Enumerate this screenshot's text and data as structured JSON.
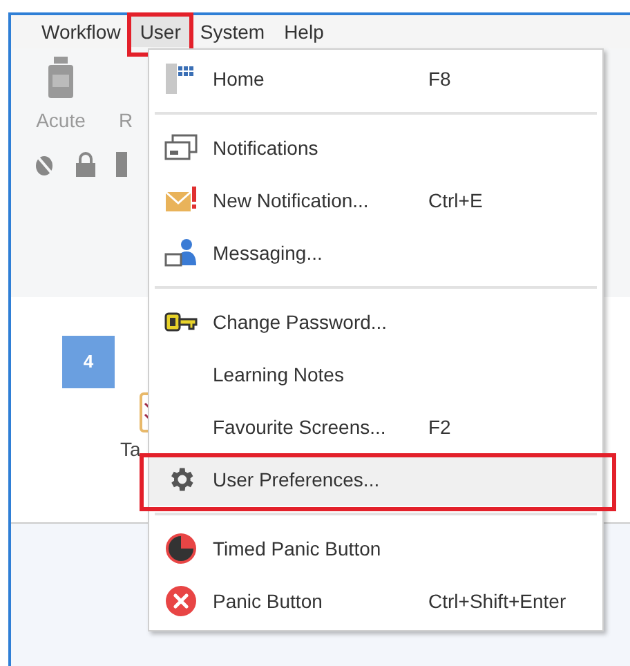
{
  "menu_bar": [
    {
      "label": "Workflow",
      "selected": false,
      "highlighted": false
    },
    {
      "label": "User",
      "selected": true,
      "highlighted": true
    },
    {
      "label": "System",
      "selected": false,
      "highlighted": false
    },
    {
      "label": "Help",
      "selected": false,
      "highlighted": false
    }
  ],
  "toolbar": {
    "buttons": [
      {
        "label": "Acute"
      },
      {
        "label": "R"
      }
    ]
  },
  "workspace": {
    "tile": {
      "badge": "4",
      "label": "Ta"
    }
  },
  "user_menu": [
    {
      "label": "Home",
      "shortcut": "F8",
      "selected": false,
      "highlighted": false,
      "separator_after": true
    },
    {
      "label": "Notifications",
      "selected": false,
      "highlighted": false,
      "separator_after": false
    },
    {
      "label": "New Notification...",
      "shortcut": "Ctrl+E",
      "selected": false,
      "highlighted": false,
      "separator_after": false
    },
    {
      "label": "Messaging...",
      "selected": false,
      "highlighted": false,
      "separator_after": true
    },
    {
      "label": "Change Password...",
      "selected": false,
      "highlighted": false,
      "separator_after": false
    },
    {
      "label": "Learning Notes",
      "selected": false,
      "highlighted": false,
      "separator_after": false
    },
    {
      "label": "Favourite Screens...",
      "shortcut": "F2",
      "selected": false,
      "highlighted": false,
      "separator_after": false
    },
    {
      "label": "User Preferences...",
      "selected": true,
      "highlighted": true,
      "separator_after": true
    },
    {
      "label": "Timed Panic Button",
      "selected": false,
      "highlighted": false,
      "separator_after": false
    },
    {
      "label": "Panic Button",
      "shortcut": "Ctrl+Shift+Enter",
      "selected": false,
      "highlighted": false,
      "separator_after": false
    }
  ]
}
